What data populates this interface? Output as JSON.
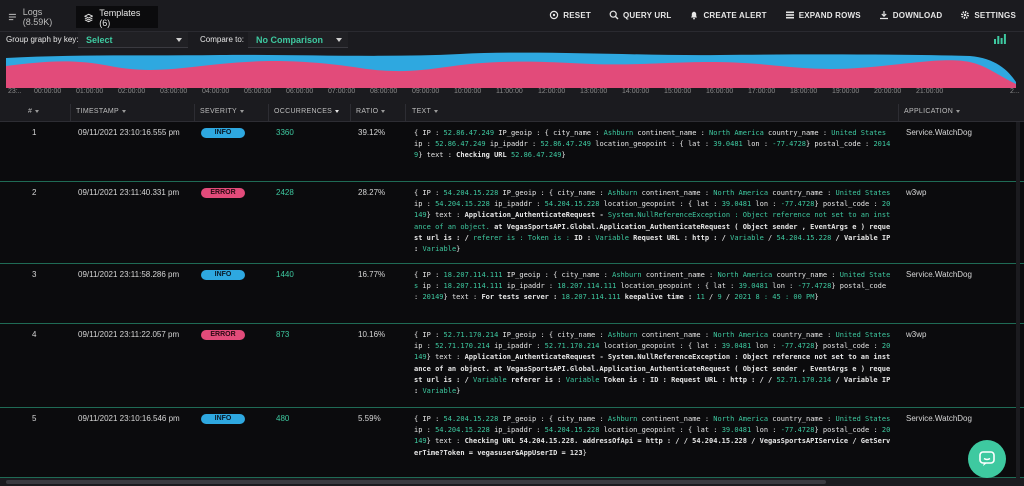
{
  "tabs": [
    {
      "label": "Logs (8.59K)",
      "icon": "list-icon"
    },
    {
      "label": "Templates (6)",
      "icon": "stack-icon"
    }
  ],
  "toolbar": {
    "reset": "RESET",
    "query_url": "QUERY URL",
    "create_alert": "CREATE ALERT",
    "expand_rows": "EXPAND ROWS",
    "download": "DOWNLOAD",
    "settings": "SETTINGS"
  },
  "filters": {
    "group_label": "Group graph by key:",
    "group_value": "Select",
    "compare_label": "Compare to:",
    "compare_value": "No Comparison"
  },
  "timeline": {
    "ticks": [
      "23:..",
      "00:00:00",
      "01:00:00",
      "02:00:00",
      "03:00:00",
      "04:00:00",
      "05:00:00",
      "06:00:00",
      "07:00:00",
      "08:00:00",
      "09:00:00",
      "10:00:00",
      "11:00:00",
      "12:00:00",
      "13:00:00",
      "14:00:00",
      "15:00:00",
      "16:00:00",
      "17:00:00",
      "18:00:00",
      "19:00:00",
      "20:00:00",
      "21:00:00",
      "2..."
    ],
    "colors": {
      "top": "#2ea8e0",
      "bottom": "#e24b7a"
    }
  },
  "columns": {
    "num": "#",
    "timestamp": "TIMESTAMP",
    "severity": "SEVERITY",
    "occurrences": "OCCURRENCES",
    "ratio": "RATIO",
    "text": "TEXT",
    "application": "APPLICATION"
  },
  "rows": [
    {
      "num": "1",
      "timestamp": "09/11/2021 23:10:16.555 pm",
      "severity": "INFO",
      "occurrences": "3360",
      "ratio": "39.12%",
      "application": "Service.WatchDog",
      "text": [
        [
          "{ IP : ",
          ""
        ],
        [
          "52.86.47.249",
          "v"
        ],
        [
          " IP_geoip : { city_name : ",
          ""
        ],
        [
          "Ashburn",
          "v"
        ],
        [
          " continent_name : ",
          ""
        ],
        [
          "North America",
          "v"
        ],
        [
          " country_name : ",
          ""
        ],
        [
          "United States",
          "v"
        ],
        [
          " ip : ",
          ""
        ],
        [
          "52.86.47.249",
          "v"
        ],
        [
          " ip_ipaddr : ",
          ""
        ],
        [
          "52.86.47.249",
          "v"
        ],
        [
          " location_geopoint : { lat : ",
          ""
        ],
        [
          "39.0481",
          "v"
        ],
        [
          " lon : ",
          ""
        ],
        [
          "-77.4728",
          "v"
        ],
        [
          "} postal_code : ",
          ""
        ],
        [
          "20149",
          "v"
        ],
        [
          "} text : ",
          ""
        ],
        [
          "Checking URL ",
          "b"
        ],
        [
          "52.86.47.249",
          "v"
        ],
        [
          "}",
          ""
        ]
      ]
    },
    {
      "num": "2",
      "timestamp": "09/11/2021 23:11:40.331 pm",
      "severity": "ERROR",
      "occurrences": "2428",
      "ratio": "28.27%",
      "application": "w3wp",
      "text": [
        [
          "{ IP : ",
          ""
        ],
        [
          "54.204.15.228",
          "v"
        ],
        [
          " IP_geoip : { city_name : ",
          ""
        ],
        [
          "Ashburn",
          "v"
        ],
        [
          " continent_name : ",
          ""
        ],
        [
          "North America",
          "v"
        ],
        [
          " country_name : ",
          ""
        ],
        [
          "United States",
          "v"
        ],
        [
          " ip : ",
          ""
        ],
        [
          "54.204.15.228",
          "v"
        ],
        [
          " ip_ipaddr : ",
          ""
        ],
        [
          "54.204.15.228",
          "v"
        ],
        [
          " location_geopoint : { lat : ",
          ""
        ],
        [
          "39.0481",
          "v"
        ],
        [
          " lon : ",
          ""
        ],
        [
          "-77.4728",
          "v"
        ],
        [
          "} postal_code : ",
          ""
        ],
        [
          "20149",
          "v"
        ],
        [
          "} text : ",
          ""
        ],
        [
          "Application_AuthenticateRequest - ",
          "b"
        ],
        [
          "System.NullReferenceException : Object reference not set to an instance of an object.",
          "v"
        ],
        [
          " at VegasSportsAPI.Global.Application_AuthenticateRequest ( Object sender , EventArgs e ) request url is : / ",
          "b"
        ],
        [
          "referer is : Token is : ",
          "v"
        ],
        [
          "ID : ",
          "b"
        ],
        [
          "Variable",
          "v"
        ],
        [
          " Request URL : http : / ",
          "b"
        ],
        [
          "Variable",
          "v"
        ],
        [
          " / ",
          ""
        ],
        [
          "54.204.15.228",
          "v"
        ],
        [
          " / Variable IP : ",
          "b"
        ],
        [
          "Variable",
          "v"
        ],
        [
          "}",
          ""
        ]
      ]
    },
    {
      "num": "3",
      "timestamp": "09/11/2021 23:11:58.286 pm",
      "severity": "INFO",
      "occurrences": "1440",
      "ratio": "16.77%",
      "application": "Service.WatchDog",
      "text": [
        [
          "{ IP : ",
          ""
        ],
        [
          "18.207.114.111",
          "v"
        ],
        [
          " IP_geoip : { city_name : ",
          ""
        ],
        [
          "Ashburn",
          "v"
        ],
        [
          " continent_name : ",
          ""
        ],
        [
          "North America",
          "v"
        ],
        [
          " country_name : ",
          ""
        ],
        [
          "United States",
          "v"
        ],
        [
          " ip : ",
          ""
        ],
        [
          "18.207.114.111",
          "v"
        ],
        [
          " ip_ipaddr : ",
          ""
        ],
        [
          "18.207.114.111",
          "v"
        ],
        [
          " location_geopoint : { lat : ",
          ""
        ],
        [
          "39.0481",
          "v"
        ],
        [
          " lon : ",
          ""
        ],
        [
          "-77.4728",
          "v"
        ],
        [
          "} postal_code : ",
          ""
        ],
        [
          "20149",
          "v"
        ],
        [
          "} text : ",
          ""
        ],
        [
          "For tests server : ",
          "b"
        ],
        [
          "18.207.114.111",
          "v"
        ],
        [
          " keepalive time : ",
          "b"
        ],
        [
          "11",
          "v"
        ],
        [
          " / ",
          ""
        ],
        [
          "9",
          "v"
        ],
        [
          " / ",
          ""
        ],
        [
          "2021 8 : 45 : 00 PM",
          "v"
        ],
        [
          "}",
          ""
        ]
      ]
    },
    {
      "num": "4",
      "timestamp": "09/11/2021 23:11:22.057 pm",
      "severity": "ERROR",
      "occurrences": "873",
      "ratio": "10.16%",
      "application": "w3wp",
      "text": [
        [
          "{ IP : ",
          ""
        ],
        [
          "52.71.170.214",
          "v"
        ],
        [
          " IP_geoip : { city_name : ",
          ""
        ],
        [
          "Ashburn",
          "v"
        ],
        [
          " continent_name : ",
          ""
        ],
        [
          "North America",
          "v"
        ],
        [
          " country_name : ",
          ""
        ],
        [
          "United States",
          "v"
        ],
        [
          " ip : ",
          ""
        ],
        [
          "52.71.170.214",
          "v"
        ],
        [
          " ip_ipaddr : ",
          ""
        ],
        [
          "52.71.170.214",
          "v"
        ],
        [
          " location_geopoint : { lat : ",
          ""
        ],
        [
          "39.0481",
          "v"
        ],
        [
          " lon : ",
          ""
        ],
        [
          "-77.4728",
          "v"
        ],
        [
          "} postal_code : ",
          ""
        ],
        [
          "20149",
          "v"
        ],
        [
          "} text : ",
          ""
        ],
        [
          "Application_AuthenticateRequest - System.NullReferenceException : Object reference not set to an instance of an object. at VegasSportsAPI.Global.Application_AuthenticateRequest ( Object sender , EventArgs e ) request url is : / ",
          "b"
        ],
        [
          "Variable",
          "v"
        ],
        [
          " referer is : ",
          "b"
        ],
        [
          "Variable",
          "v"
        ],
        [
          " Token is : ID : Request URL : http : / / ",
          "b"
        ],
        [
          "52.71.170.214",
          "v"
        ],
        [
          " / Variable IP : ",
          "b"
        ],
        [
          "Variable",
          "v"
        ],
        [
          "}",
          ""
        ]
      ]
    },
    {
      "num": "5",
      "timestamp": "09/11/2021 23:10:16.546 pm",
      "severity": "INFO",
      "occurrences": "480",
      "ratio": "5.59%",
      "application": "Service.WatchDog",
      "text": [
        [
          "{ IP : ",
          ""
        ],
        [
          "54.204.15.228",
          "v"
        ],
        [
          " IP_geoip : { city_name : ",
          ""
        ],
        [
          "Ashburn",
          "v"
        ],
        [
          " continent_name : ",
          ""
        ],
        [
          "North America",
          "v"
        ],
        [
          " country_name : ",
          ""
        ],
        [
          "United States",
          "v"
        ],
        [
          " ip : ",
          ""
        ],
        [
          "54.204.15.228",
          "v"
        ],
        [
          " ip_ipaddr : ",
          ""
        ],
        [
          "54.204.15.228",
          "v"
        ],
        [
          " location_geopoint : { lat : ",
          ""
        ],
        [
          "39.0481",
          "v"
        ],
        [
          " lon : ",
          ""
        ],
        [
          "-77.4728",
          "v"
        ],
        [
          "} postal_code : ",
          ""
        ],
        [
          "20149",
          "v"
        ],
        [
          "} text : ",
          ""
        ],
        [
          "Checking URL 54.204.15.228. addressOfApi = http : / / 54.204.15.228 / VegasSportsAPIService / GetServerTime?Token = vegasuser&AppUserID = 123",
          "b"
        ],
        [
          "}",
          ""
        ]
      ]
    }
  ]
}
